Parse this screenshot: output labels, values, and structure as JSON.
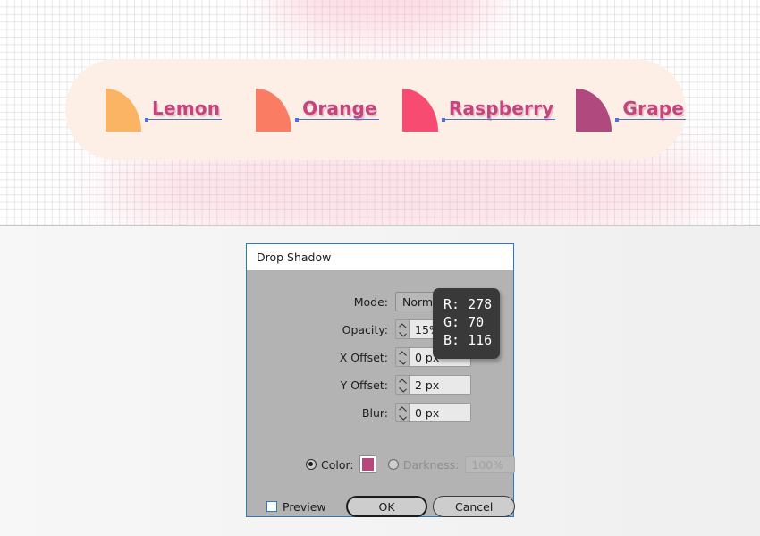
{
  "canvas": {
    "card": {
      "background_color": "#fdeee6",
      "items": [
        {
          "label": "Lemon",
          "wedge_color": "#fbb463"
        },
        {
          "label": "Orange",
          "wedge_color": "#fa7c63"
        },
        {
          "label": "Raspberry",
          "wedge_color": "#f74b72"
        },
        {
          "label": "Grape",
          "wedge_color": "#b0497e"
        }
      ]
    },
    "label_text_color": "#c4457c"
  },
  "dialog": {
    "title": "Drop Shadow",
    "accent_border_color": "#2a79c4",
    "fields": [
      {
        "label": "Mode:",
        "type": "select",
        "value": "Normal"
      },
      {
        "label": "Opacity:",
        "type": "spinner",
        "value": "15%"
      },
      {
        "label": "X Offset:",
        "type": "spinner",
        "value": "0 px"
      },
      {
        "label": "Y Offset:",
        "type": "spinner",
        "value": "2 px"
      },
      {
        "label": "Blur:",
        "type": "spinner",
        "value": "0 px"
      }
    ],
    "color_row": {
      "color_label": "Color:",
      "color_selected": true,
      "swatch_color": "#b8487c",
      "darkness_label": "Darkness:",
      "darkness_selected": false,
      "darkness_value": "100%",
      "darkness_disabled": true
    },
    "footer": {
      "preview_label": "Preview",
      "preview_checked": false,
      "ok_label": "OK",
      "cancel_label": "Cancel"
    }
  },
  "rgb_readout": {
    "r": "R: 278",
    "g": "G: 70",
    "b": "B: 116"
  }
}
